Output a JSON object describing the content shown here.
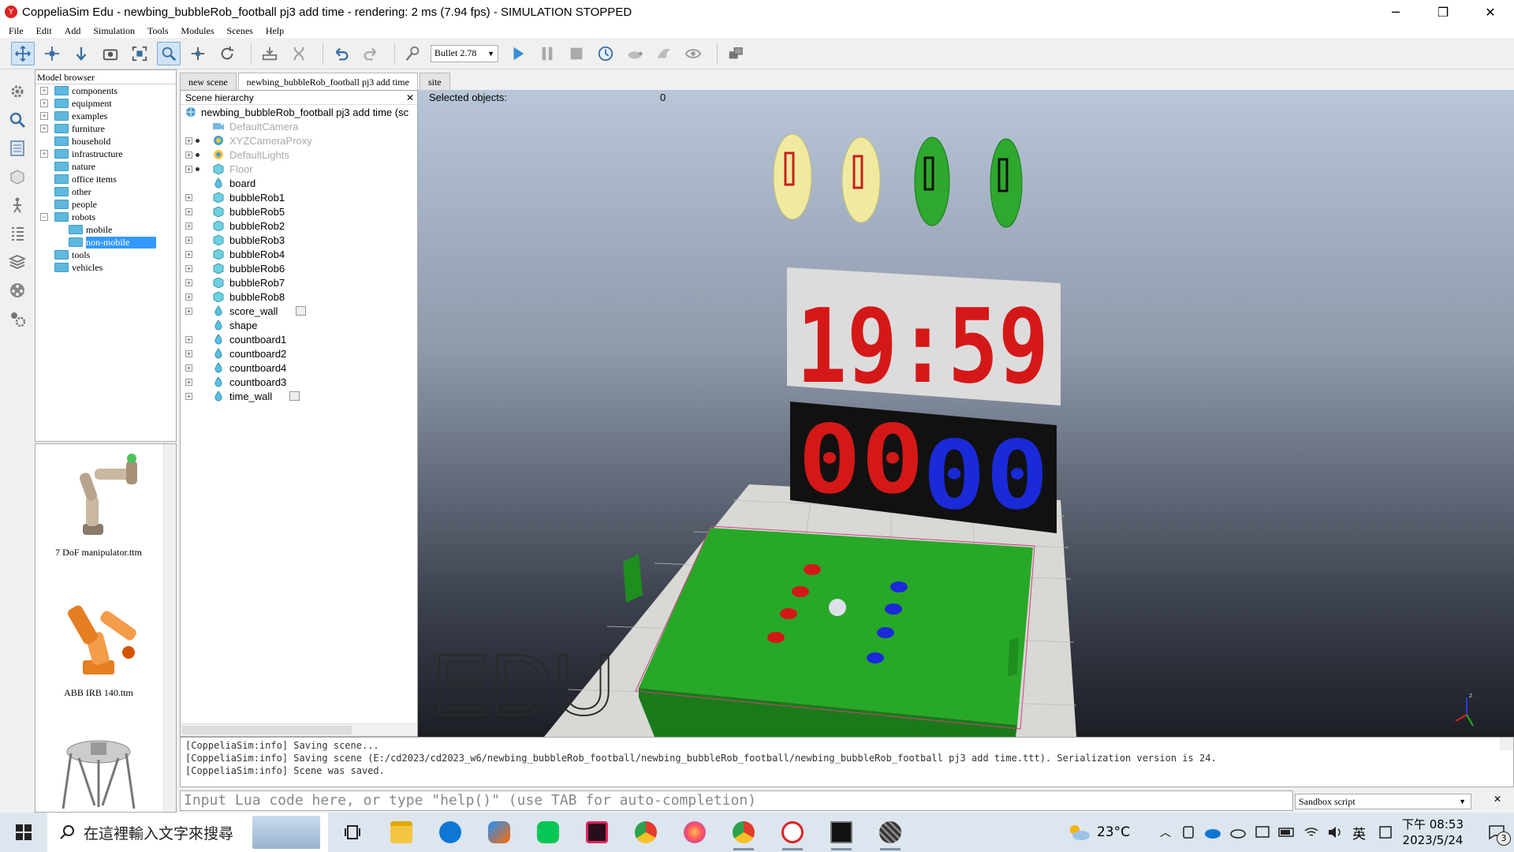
{
  "window": {
    "title": "CoppeliaSim Edu - newbing_bubbleRob_football pj3 add time - rendering: 2 ms (7.94 fps) - SIMULATION STOPPED",
    "minimize": "─",
    "restore": "❐",
    "close": "✕"
  },
  "menu": [
    "File",
    "Edit",
    "Add",
    "Simulation",
    "Tools",
    "Modules",
    "Scenes",
    "Help"
  ],
  "toolbar": {
    "engine": "Bullet 2.78",
    "icons": [
      "camera-pan-icon",
      "camera-rotate-icon",
      "camera-shift-icon",
      "camera-opening-icon",
      "fit-to-view-icon",
      "object-select-icon",
      "object-shift-icon",
      "object-rotate-icon",
      "assemble-icon",
      "transfer-dna-icon",
      "undo-icon",
      "redo-icon",
      "dynamics-content-icon",
      "start-simulation-icon",
      "pause-simulation-icon",
      "stop-simulation-icon",
      "real-time-icon",
      "slow-down-icon",
      "speed-up-icon",
      "visualization-icon",
      "toggle-views-icon"
    ]
  },
  "left_icons": [
    "scene-settings-icon",
    "selection-icon",
    "calculation-modules-icon",
    "collections-icon",
    "scripts-icon",
    "shapes-edit-icon",
    "layers-icon",
    "video-recorder-icon",
    "user-settings-icon"
  ],
  "model_browser": {
    "title": "Model browser",
    "items": [
      {
        "label": "components",
        "expand": "+"
      },
      {
        "label": "equipment",
        "expand": "+"
      },
      {
        "label": "examples",
        "expand": "+"
      },
      {
        "label": "furniture",
        "expand": "+"
      },
      {
        "label": "household",
        "expand": ""
      },
      {
        "label": "infrastructure",
        "expand": "+"
      },
      {
        "label": "nature",
        "expand": ""
      },
      {
        "label": "office items",
        "expand": ""
      },
      {
        "label": "other",
        "expand": ""
      },
      {
        "label": "people",
        "expand": ""
      },
      {
        "label": "robots",
        "expand": "−"
      },
      {
        "label": "mobile",
        "child": true
      },
      {
        "label": "non-mobile",
        "child": true,
        "selected": true
      },
      {
        "label": "tools",
        "expand": ""
      },
      {
        "label": "vehicles",
        "expand": ""
      }
    ],
    "thumbnails": [
      "7 DoF manipulator.ttm",
      "ABB IRB 140.ttm"
    ]
  },
  "tabs": [
    "new scene",
    "newbing_bubbleRob_football pj3 add time",
    "site"
  ],
  "hierarchy": {
    "title": "Scene hierarchy",
    "close": "✕",
    "root": "newbing_bubbleRob_football pj3 add time (sc",
    "rows": [
      {
        "label": "DefaultCamera",
        "icon": "camera",
        "dim": true,
        "exp": false
      },
      {
        "label": "XYZCameraProxy",
        "icon": "proxy",
        "dim": true,
        "exp": true
      },
      {
        "label": "DefaultLights",
        "icon": "lights",
        "dim": true,
        "exp": true
      },
      {
        "label": "Floor",
        "icon": "cube",
        "dim": true,
        "exp": true
      },
      {
        "label": "board",
        "icon": "shape",
        "exp": false
      },
      {
        "label": "bubbleRob1",
        "icon": "cube",
        "exp": true
      },
      {
        "label": "bubbleRob5",
        "icon": "cube",
        "exp": true
      },
      {
        "label": "bubbleRob2",
        "icon": "cube",
        "exp": true
      },
      {
        "label": "bubbleRob3",
        "icon": "cube",
        "exp": true
      },
      {
        "label": "bubbleRob4",
        "icon": "cube",
        "exp": true
      },
      {
        "label": "bubbleRob6",
        "icon": "cube",
        "exp": true
      },
      {
        "label": "bubbleRob7",
        "icon": "cube",
        "exp": true
      },
      {
        "label": "bubbleRob8",
        "icon": "cube",
        "exp": true
      },
      {
        "label": "score_wall",
        "icon": "shape",
        "exp": true,
        "script": true
      },
      {
        "label": "shape",
        "icon": "shape",
        "exp": false
      },
      {
        "label": "countboard1",
        "icon": "shape",
        "exp": true
      },
      {
        "label": "countboard2",
        "icon": "shape",
        "exp": true
      },
      {
        "label": "countboard4",
        "icon": "shape",
        "exp": true
      },
      {
        "label": "countboard3",
        "icon": "shape",
        "exp": true
      },
      {
        "label": "time_wall",
        "icon": "shape",
        "exp": true,
        "script": true
      }
    ]
  },
  "viewport": {
    "selected_label": "Selected objects:",
    "selected_count": "0",
    "watermark": "EDU",
    "score_red": "00",
    "score_blue": "00",
    "timer": "19:59",
    "axis_label": "z"
  },
  "console": {
    "lines": [
      "[CoppeliaSim:info] Saving scene...",
      "[CoppeliaSim:info] Saving scene (E:/cd2023/cd2023_w6/newbing_bubbleRob_football/newbing_bubbleRob_football/newbing_bubbleRob_football pj3 add time.ttt). Serialization version is 24.",
      "[CoppeliaSim:info] Scene was saved."
    ]
  },
  "lua": {
    "placeholder": "Input Lua code here, or type \"help()\" (use TAB for auto-completion)",
    "script_select": "Sandbox script",
    "close": "✕"
  },
  "taskbar": {
    "search_placeholder": "在這裡輸入文字來搜尋",
    "apps": [
      "task-view-icon",
      "file-explorer-icon",
      "edge-icon",
      "photos-icon",
      "line-icon",
      "media-icon",
      "chrome-icon",
      "firefox-icon",
      "chrome-profile-icon",
      "coppeliasim-icon",
      "terminal-icon",
      "app-icon"
    ],
    "weather": "23°C",
    "ime": "英",
    "time": "下午 08:53",
    "date": "2023/5/24",
    "notifications": "3",
    "colors": {
      "accent": "#3399ff",
      "edge": "#0e77d4",
      "line": "#06c755",
      "chrome": "#e33b2e"
    }
  }
}
